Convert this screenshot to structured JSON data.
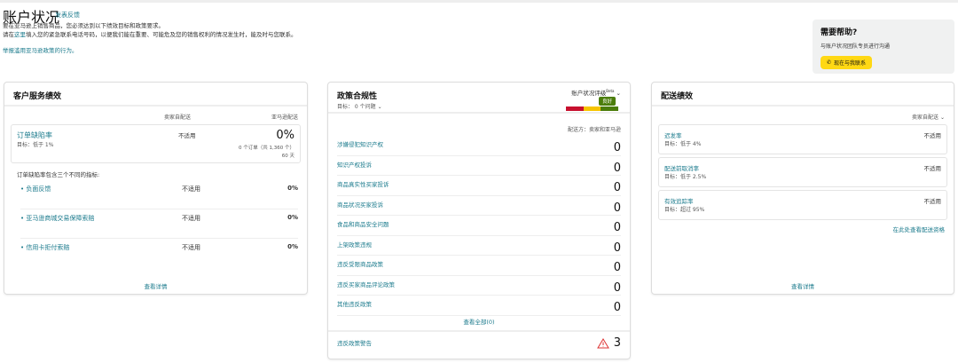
{
  "header": {
    "title": "账户状况",
    "feedback": "发表反馈",
    "intro_line1": "要在亚马逊上销售商品，您必须达到以下绩效目标和政策要求。",
    "intro_line2_pre": "请在",
    "intro_line2_link": "这里",
    "intro_line2_post": "填入您的紧急联系电话号码，以便我们能在重要、可能危及您的销售权利的情况发生时，能及时与您联系。",
    "report_link": "举报滥用亚马逊政策的行为。"
  },
  "help": {
    "title": "需要帮助?",
    "text": "与账户状况团队专员进行沟通",
    "button": "现在与我联系"
  },
  "customer_service": {
    "title": "客户服务绩效",
    "col_seller": "卖家自配送",
    "col_amazon": "亚马逊配送",
    "odr": {
      "label": "订单缺陷率",
      "target": "目标：低于 1%",
      "seller": "不适用",
      "amazon": "0%",
      "orders": "0 个订单（共 1,360 个）",
      "days": "60 天"
    },
    "metrics_intro": "订单缺陷率包含三个不同的指标:",
    "metrics": [
      {
        "label": "负面反馈",
        "seller": "不适用",
        "amazon": "0%"
      },
      {
        "label": "亚马逊商城交易保障索赔",
        "seller": "不适用",
        "amazon": "0%"
      },
      {
        "label": "信用卡拒付索赔",
        "seller": "不适用",
        "amazon": "0%"
      }
    ],
    "view_details": "查看详情"
  },
  "policy": {
    "title": "政策合规性",
    "target": "目标： 0 个问题",
    "rating_label": "账户状况评级",
    "beta": "Beta",
    "rating": "良好",
    "fulfilled_by": "配送方：卖家和亚马逊",
    "items": [
      {
        "label": "涉嫌侵犯知识产权",
        "value": "0"
      },
      {
        "label": "知识产权投诉",
        "value": "0"
      },
      {
        "label": "商品真实性买家投诉",
        "value": "0"
      },
      {
        "label": "商品状况买家投诉",
        "value": "0"
      },
      {
        "label": "食品和商品安全问题",
        "value": "0"
      },
      {
        "label": "上架政策违规",
        "value": "0"
      },
      {
        "label": "违反受限商品政策",
        "value": "0"
      },
      {
        "label": "违反买家商品评论政策",
        "value": "0"
      },
      {
        "label": "其他违反政策",
        "value": "0"
      }
    ],
    "view_all": "查看全部(0)",
    "warnings_label": "违反政策警告",
    "warnings_value": "3",
    "colors": {
      "red": "#c7102e",
      "yellow": "#f6c400",
      "green": "#4b7d0a"
    }
  },
  "shipping": {
    "title": "配送绩效",
    "filter": "卖家自配送",
    "items": [
      {
        "label": "迟发率",
        "target": "目标：低于 4%",
        "value": "不适用"
      },
      {
        "label": "配送前取消率",
        "target": "目标：低于 2.5%",
        "value": "不适用"
      },
      {
        "label": "有效追踪率",
        "target": "目标：超过 95%",
        "value": "不适用"
      }
    ],
    "eligibility_link": "在此处查看配送资格",
    "view_details": "查看详情"
  }
}
